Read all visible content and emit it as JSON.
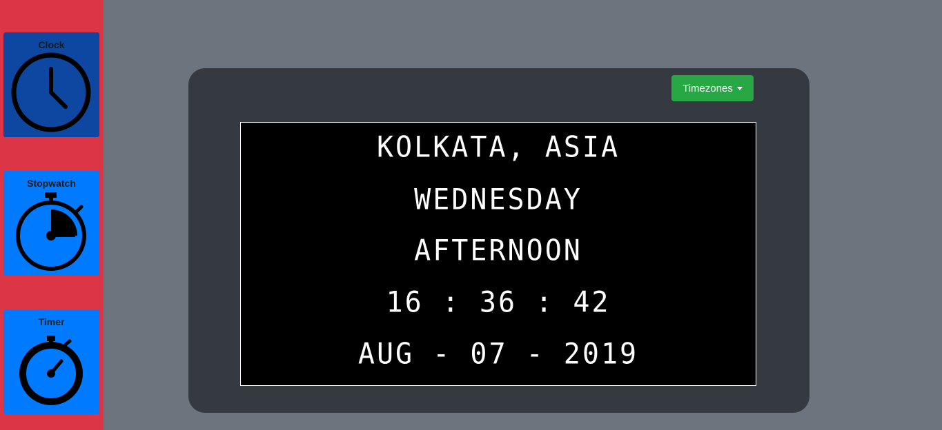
{
  "sidebar": {
    "items": [
      {
        "label": "Clock",
        "icon": "clock-icon",
        "active": true
      },
      {
        "label": "Stopwatch",
        "icon": "stopwatch-icon",
        "active": false
      },
      {
        "label": "Timer",
        "icon": "timer-icon",
        "active": false
      }
    ]
  },
  "header": {
    "timezone_button_label": "Timezones"
  },
  "display": {
    "location": "KOLKATA, ASIA",
    "weekday": "WEDNESDAY",
    "period": "AFTERNOON",
    "time": "16 : 36 : 42",
    "date": "AUG - 07 - 2019"
  },
  "colors": {
    "sidebar": "#dc3545",
    "active_tile": "#0d47a1",
    "tile": "#007bff",
    "page_background": "#6c757d",
    "panel": "#343a40",
    "button": "#28a745",
    "screen": "#000000"
  }
}
